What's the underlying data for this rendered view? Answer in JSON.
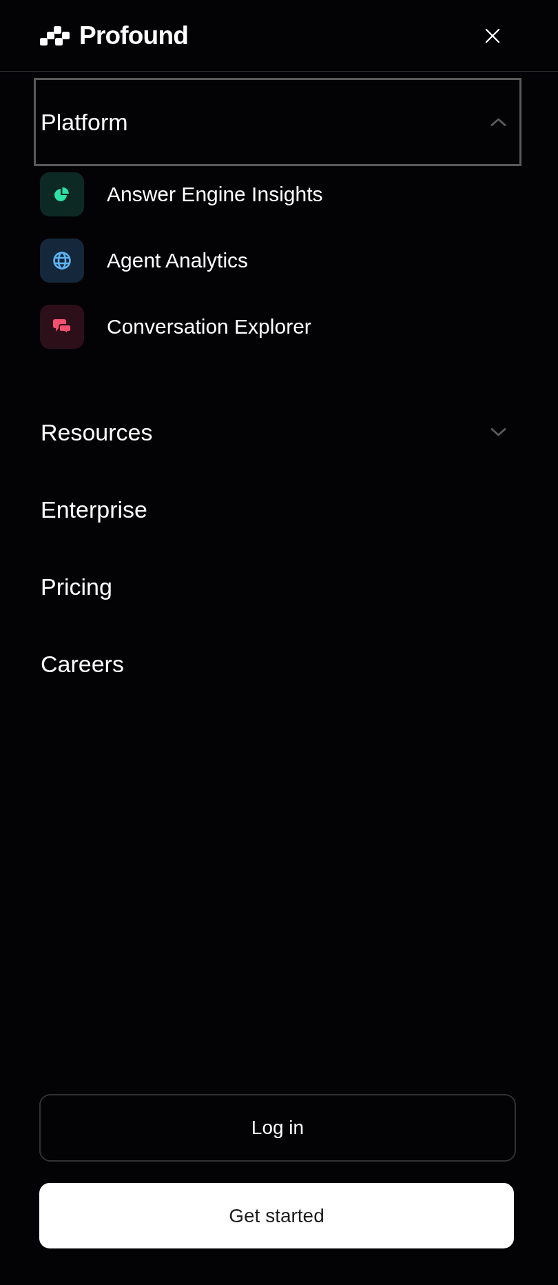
{
  "header": {
    "brand": "Profound"
  },
  "nav": [
    {
      "label": "Platform",
      "kind": "dropdown",
      "expanded": true,
      "focused": true,
      "children": [
        {
          "label": "Answer Engine Insights"
        },
        {
          "label": "Agent Analytics"
        },
        {
          "label": "Conversation Explorer"
        }
      ]
    },
    {
      "label": "Resources",
      "kind": "dropdown",
      "expanded": false,
      "focused": false
    },
    {
      "label": "Enterprise",
      "kind": "link",
      "focused": false
    },
    {
      "label": "Pricing",
      "kind": "link",
      "focused": false
    },
    {
      "label": "Careers",
      "kind": "link",
      "focused": false
    }
  ],
  "actions": [
    {
      "label": "Log in",
      "kind": "outline"
    },
    {
      "label": "Get started",
      "kind": "primary"
    }
  ]
}
